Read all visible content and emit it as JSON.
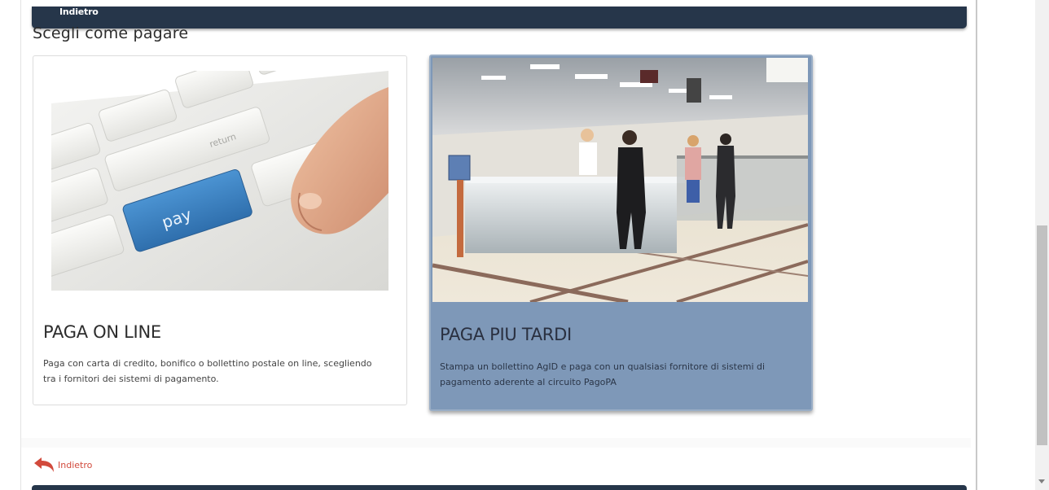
{
  "header": {
    "back_label": "Indietro"
  },
  "section_title": "Scegli come pagare",
  "cards": [
    {
      "title": "PAGA ON LINE",
      "description": "Paga con carta di credito, bonifico o bollettino postale on line, scegliendo tra i fornitori dei sistemi di pagamento.",
      "image_key_text": "pay",
      "image_key_text_2": "return"
    },
    {
      "title": "PAGA PIU TARDI",
      "description": "Stampa un bollettino AgID e paga con un qualsiasi fornitore di sistemi di pagamento aderente al circuito PagoPA"
    }
  ],
  "footer": {
    "back_label": "Indietro"
  },
  "colors": {
    "header_bg": "#26364a",
    "selected_card_bg": "#7e98b8",
    "back_link": "#d24a3c",
    "pay_key": "#3f86c8"
  },
  "icons": {
    "back": "reply-arrow-icon"
  }
}
